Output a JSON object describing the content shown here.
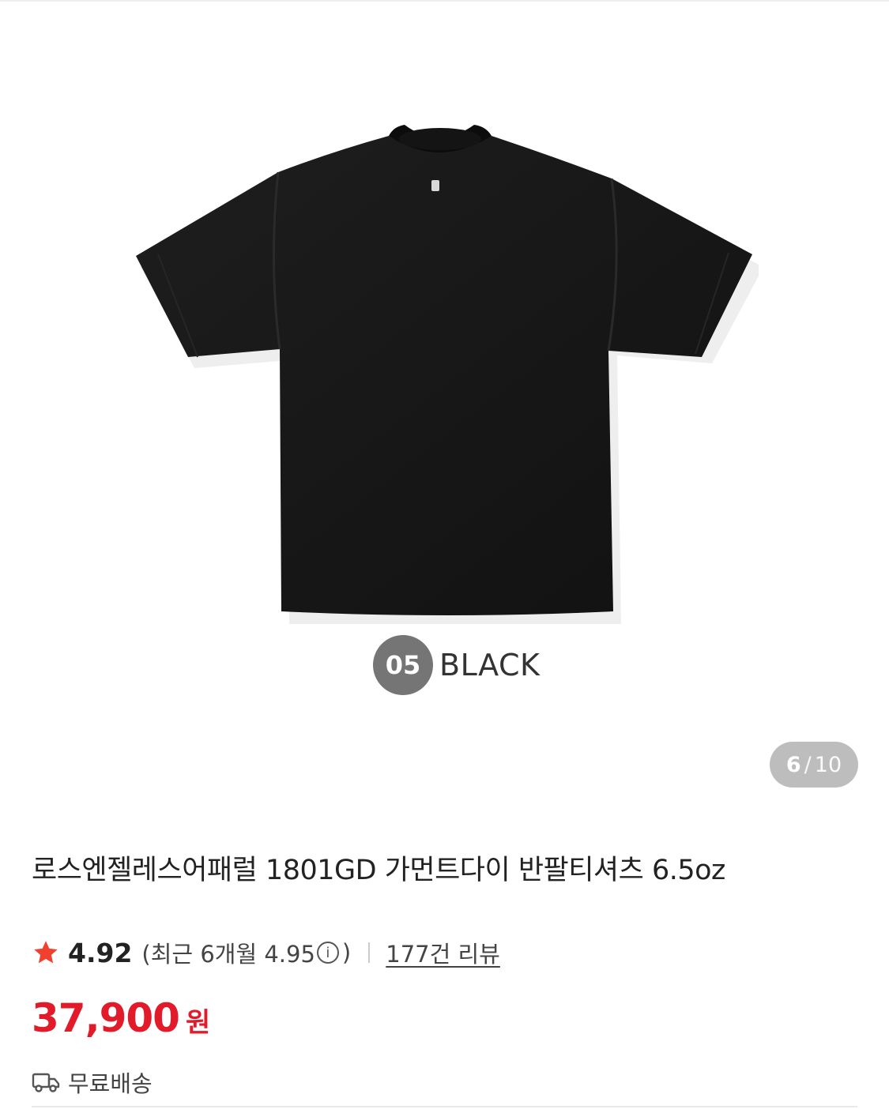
{
  "gallery": {
    "color_code": "05",
    "color_name": "BLACK",
    "current_index": "6",
    "separator": "/",
    "total": "10"
  },
  "product": {
    "title": "로스엔젤레스어패럴 1801GD 가먼트다이 반팔티셔츠 6.5oz",
    "rating": "4.92",
    "recent_prefix": "(최근 6개월 4.95",
    "recent_suffix": ")",
    "reviews_link": "177건 리뷰",
    "price": "37,900",
    "currency": "원",
    "shipping": "무료배송"
  },
  "colors": {
    "accent": "#e11b2a",
    "star": "#f1412e",
    "indicator_bg": "#bdbdbd"
  },
  "icons": [
    "star-icon",
    "info-icon",
    "truck-icon"
  ]
}
